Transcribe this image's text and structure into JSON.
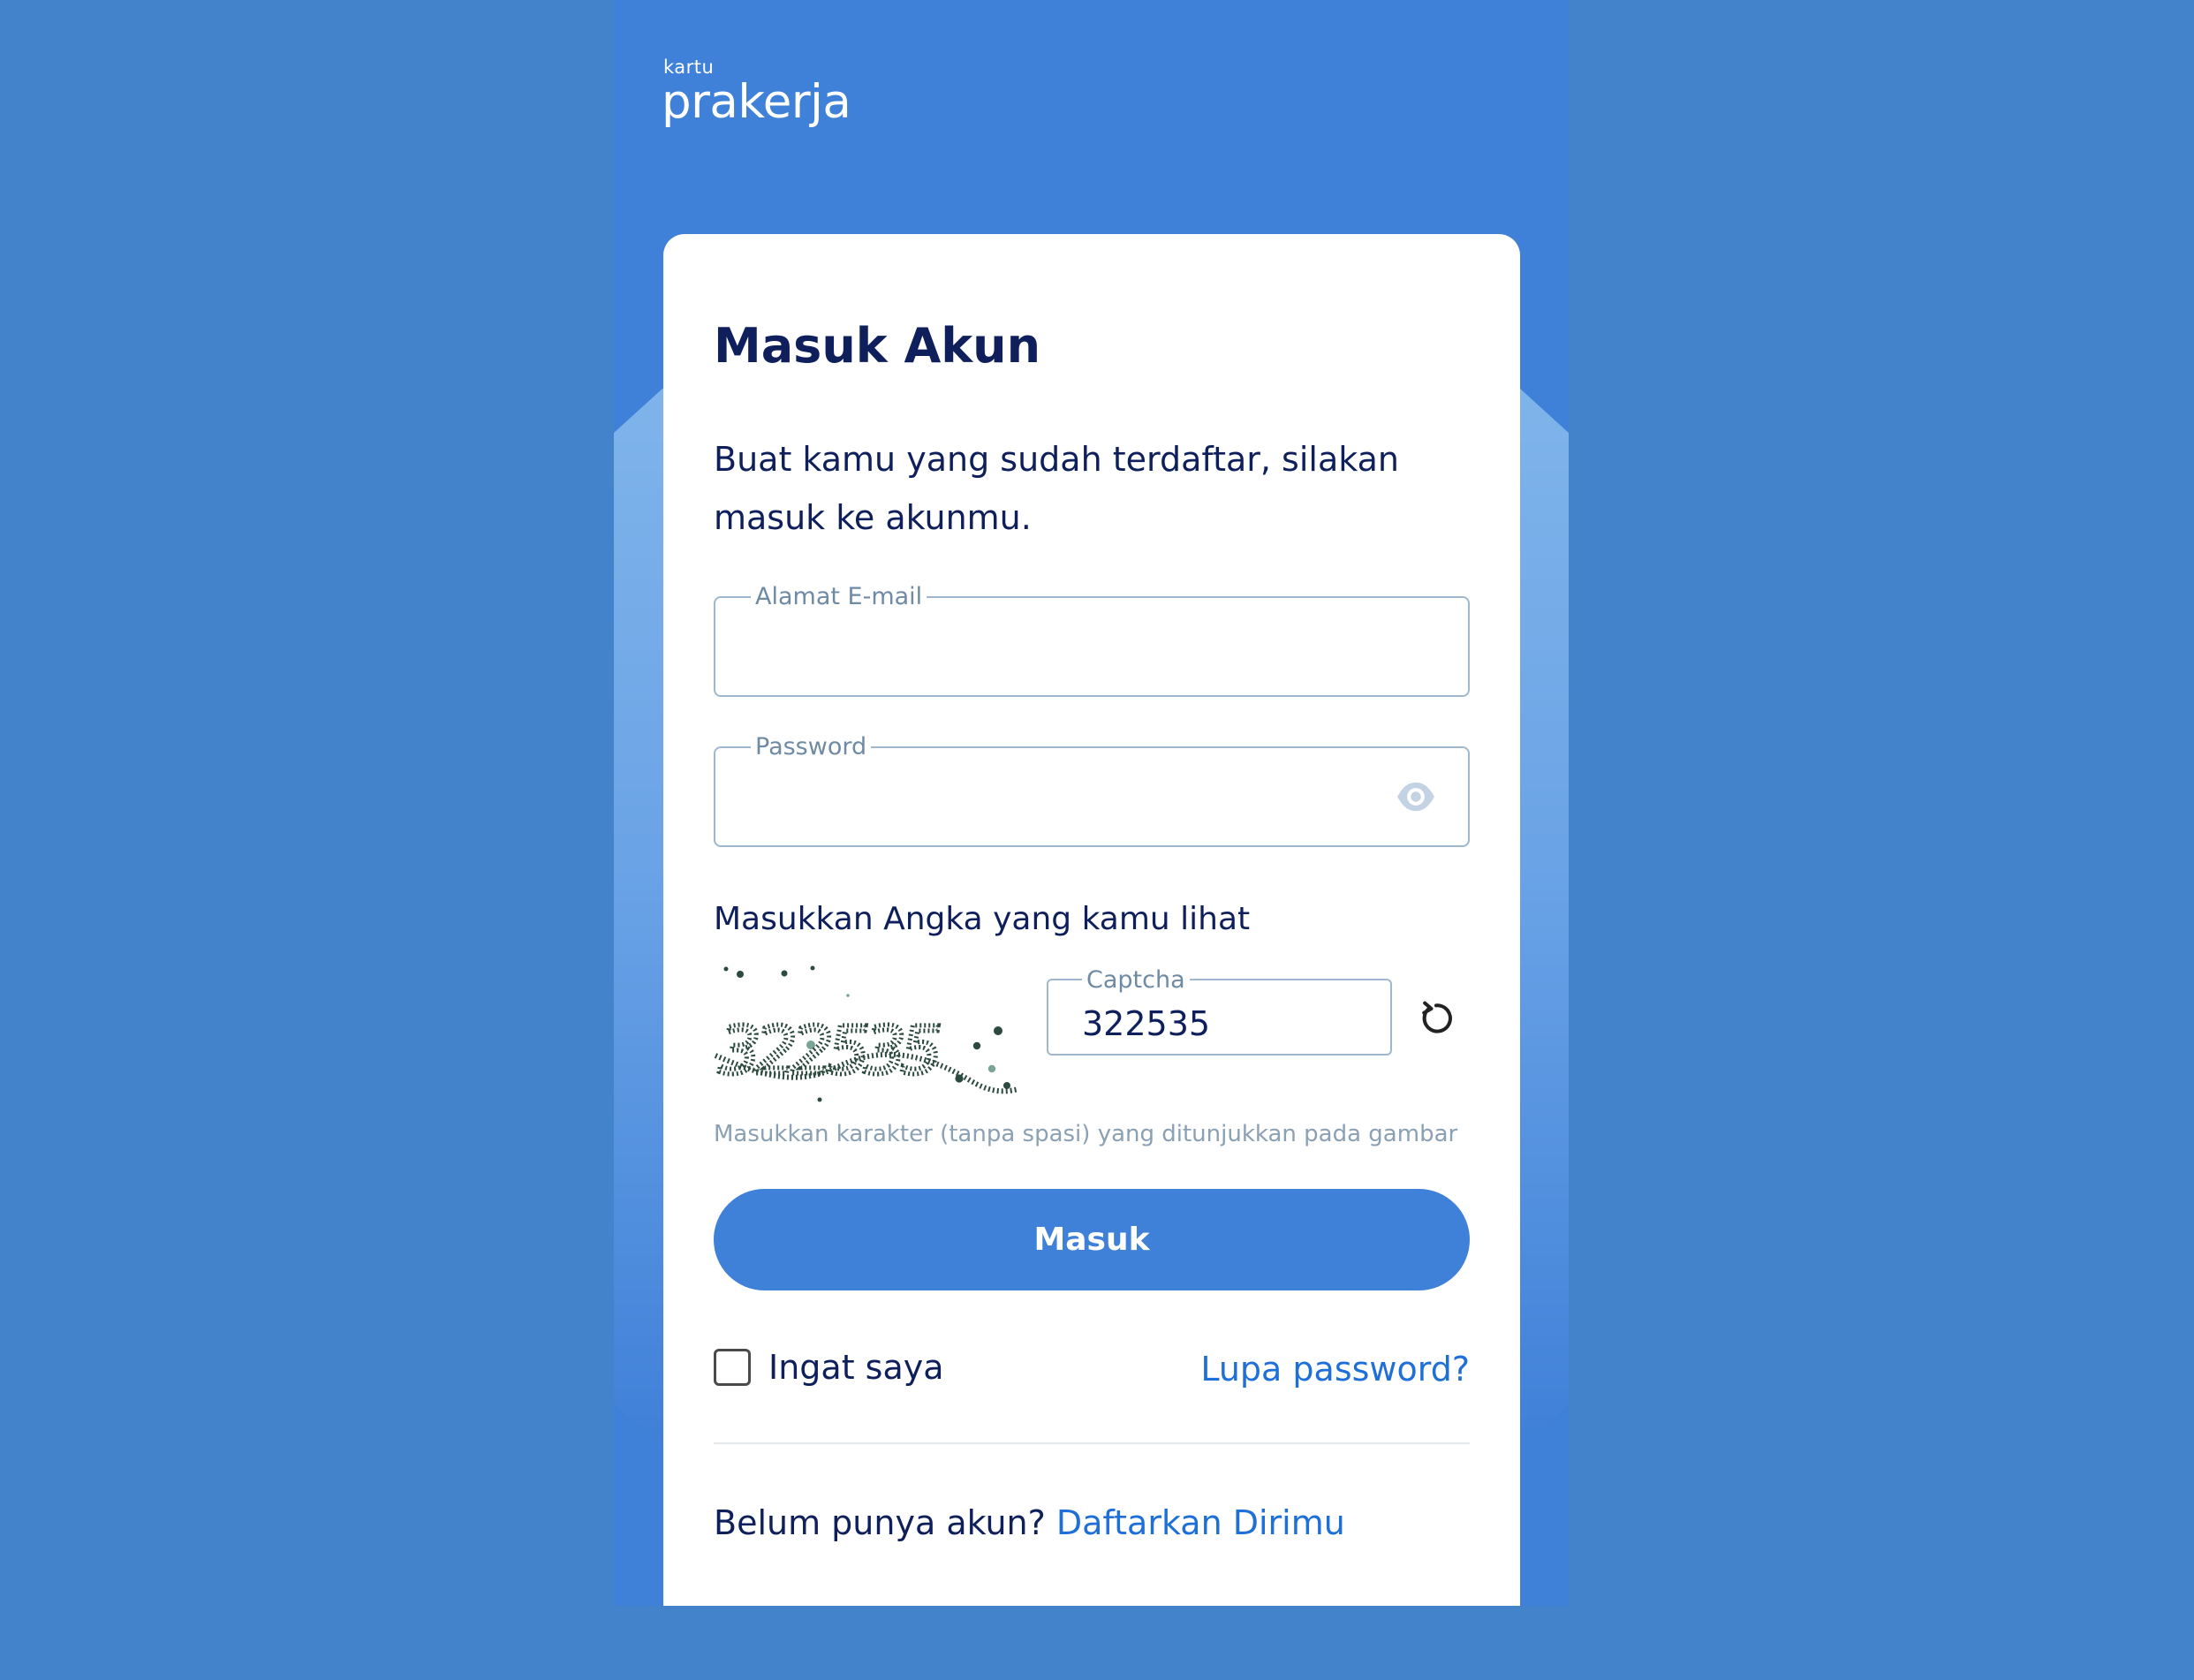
{
  "brand": {
    "logo_small": "kartu",
    "logo_large": "prakerja"
  },
  "login": {
    "title": "Masuk Akun",
    "subtitle": "Buat kamu yang sudah terdaftar, silakan masuk ke akunmu.",
    "email": {
      "label": "Alamat E-mail",
      "value": ""
    },
    "password": {
      "label": "Password",
      "value": "",
      "toggle_icon": "eye-icon"
    },
    "captcha": {
      "heading": "Masukkan Angka yang kamu lihat",
      "image_text": "322535",
      "label": "Captcha",
      "value": "322535",
      "refresh_icon": "refresh-icon",
      "hint": "Masukkan karakter (tanpa spasi) yang ditunjukkan pada gambar"
    },
    "submit_label": "Masuk",
    "remember_label": "Ingat saya",
    "remember_checked": false,
    "forgot_label": "Lupa password?",
    "register_prompt": "Belum punya akun?",
    "register_link": "Daftarkan Dirimu"
  },
  "colors": {
    "page_background": "#4283cc",
    "primary": "#3f80d8",
    "heading_text": "#0e1f5b",
    "link": "#1f6fd8",
    "field_border": "#9fb8cf",
    "hint_text": "#8aa0b4"
  }
}
